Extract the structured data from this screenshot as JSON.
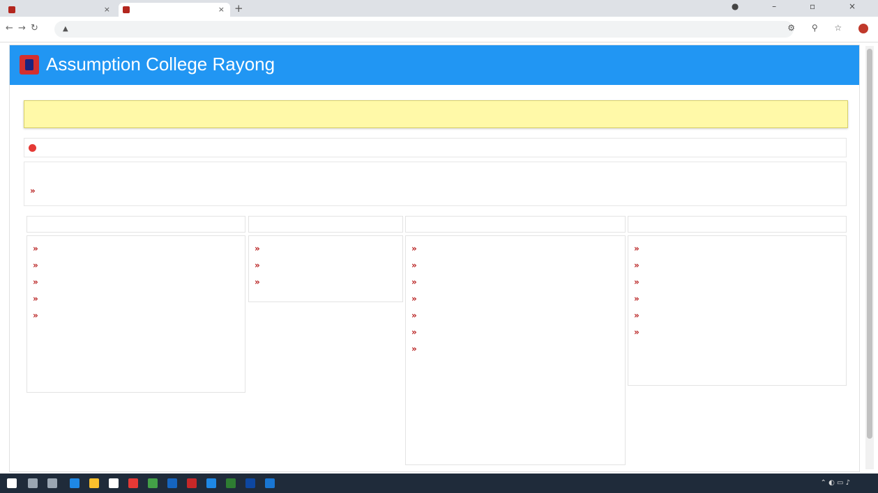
{
  "browser": {
    "tabs": [
      {
        "label": ""
      },
      {
        "label": ""
      }
    ],
    "url": ""
  },
  "site": {
    "title": "Assumption College Rayong"
  },
  "banner": {
    "text": ""
  },
  "summary_link": {
    "label": ""
  },
  "intl_section": {
    "title": "",
    "links": [
      {
        "label": ""
      }
    ]
  },
  "columns": [
    {
      "heading": "",
      "links": [
        {
          "label": ""
        },
        {
          "label": ""
        },
        {
          "label": ""
        },
        {
          "label": ""
        },
        {
          "label": ""
        }
      ]
    },
    {
      "heading": "",
      "links": [
        {
          "label": ""
        },
        {
          "label": ""
        },
        {
          "label": ""
        }
      ]
    },
    {
      "heading": "",
      "links": [
        {
          "label": ""
        },
        {
          "label": ""
        },
        {
          "label": ""
        },
        {
          "label": ""
        },
        {
          "label": ""
        },
        {
          "label": ""
        },
        {
          "label": ""
        }
      ]
    },
    {
      "heading": "",
      "links": [
        {
          "label": ""
        },
        {
          "label": ""
        },
        {
          "label": ""
        },
        {
          "label": ""
        },
        {
          "label": ""
        },
        {
          "label": ""
        }
      ]
    }
  ],
  "colors": {
    "header_blue": "#2196f3",
    "banner_yellow": "#fff9a8",
    "accent_red": "#e53935",
    "taskbar": "#1f2b3a"
  },
  "icons": {
    "tab_favicon": "college-favicon-icon",
    "bullet": "double-chevron-right-icon",
    "summary_marker": "red-circle-icon",
    "logo": "college-logo-icon"
  }
}
